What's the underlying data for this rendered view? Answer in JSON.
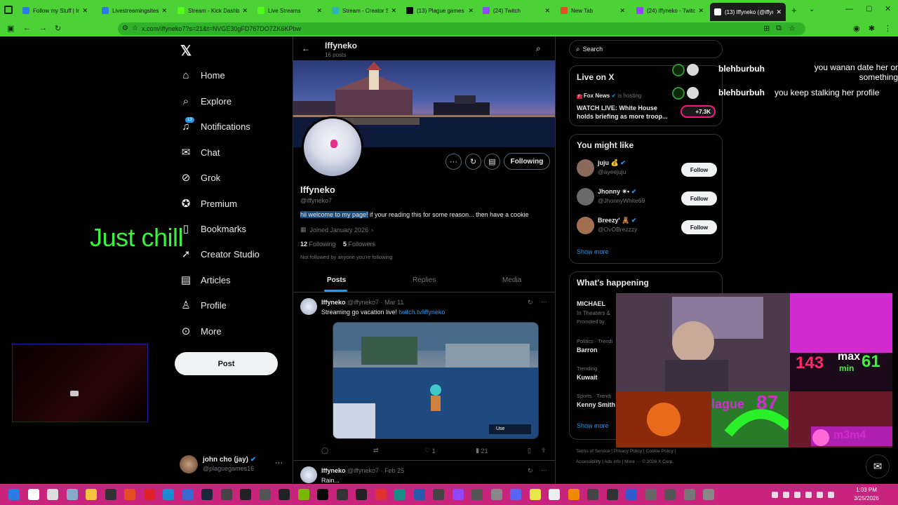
{
  "browser": {
    "tabs": [
      {
        "title": "Follow my Stuff | Insta",
        "color": "#2b7be4"
      },
      {
        "title": "Livestreamingsites | To",
        "color": "#2b7be4"
      },
      {
        "title": "Stream - Kick Dashbo",
        "color": "#53fc18"
      },
      {
        "title": "Live Streams",
        "color": "#53fc18"
      },
      {
        "title": "Stream - Creator Studi",
        "color": "#2bb5b5"
      },
      {
        "title": "(13) Plague games 16",
        "color": "#000000"
      },
      {
        "title": "(24) Twitch",
        "color": "#9146ff"
      },
      {
        "title": "New Tab",
        "color": "#e44d26"
      },
      {
        "title": "(24) iffyneko - Twitch",
        "color": "#9146ff"
      },
      {
        "title": "(13) Iffyneko (@iffyne",
        "color": "#000000"
      }
    ],
    "url": "x.com/iffyneko7?s=21&t=NVGE30gFD767DO7ZK6KPbw"
  },
  "overlay": {
    "chill_text": "Just chill",
    "chat": [
      {
        "user": "blehburbuh",
        "message": "you wanan date her or something"
      },
      {
        "user": "blehburbuh",
        "message": "you keep stalking her profile"
      }
    ],
    "stats_max": "max",
    "stats_min": "min",
    "stats_left": "143",
    "stats_right": "61",
    "plague_text": "lague",
    "plague_num": "87",
    "tag": "m3m4"
  },
  "nav": {
    "items": [
      {
        "label": "Home",
        "icon": "home-icon"
      },
      {
        "label": "Explore",
        "icon": "search-icon"
      },
      {
        "label": "Notifications",
        "icon": "bell-icon",
        "badge": "13"
      },
      {
        "label": "Chat",
        "icon": "mail-icon"
      },
      {
        "label": "Grok",
        "icon": "grok-icon"
      },
      {
        "label": "Premium",
        "icon": "verified-icon"
      },
      {
        "label": "Bookmarks",
        "icon": "bookmark-icon"
      },
      {
        "label": "Creator Studio",
        "icon": "rocket-icon"
      },
      {
        "label": "Articles",
        "icon": "article-icon"
      },
      {
        "label": "Profile",
        "icon": "person-icon"
      },
      {
        "label": "More",
        "icon": "more-icon"
      }
    ],
    "post_label": "Post",
    "account_name": "john cho (jay)",
    "account_handle": "@plaguegames16"
  },
  "profile": {
    "name": "Iffyneko",
    "posts_count": "16 posts",
    "handle": "@iffyneko7",
    "bio_highlight": "hii welcome to my page!",
    "bio_rest": " if your reading this for some reason... then have a cookie",
    "joined": "Joined January 2026",
    "following_count": "12",
    "following_label": "Following",
    "followers_count": "5",
    "followers_label": "Followers",
    "not_followed": "Not followed by anyone you're following",
    "following_button": "Following",
    "tabs": [
      "Posts",
      "Replies",
      "Media"
    ]
  },
  "tweets": [
    {
      "name": "Iffyneko",
      "handle": "@iffyneko7",
      "date": "Mar 11",
      "text": "Streaming go vacation live! ",
      "link": "twitch.tv/iffyneko",
      "replies": "",
      "retweets": "",
      "likes": "1",
      "views": "21",
      "media_label": "Use"
    },
    {
      "name": "Iffyneko",
      "handle": "@iffyneko7",
      "date": "Feb 25",
      "text": "Rain..."
    }
  ],
  "sidebar": {
    "search_placeholder": "Search",
    "live_title": "Live on X",
    "live_host": "Fox News",
    "live_hosting": "is hosting",
    "live_text": "WATCH LIVE: White House holds briefing as more troop...",
    "live_count": "+7.3K",
    "might_like_title": "You might like",
    "suggestions": [
      {
        "name": "juju 💰",
        "handle": "@ayeejuju",
        "color": "#8a6a5a"
      },
      {
        "name": "Jhonny ✴•",
        "handle": "@JhonnyWhite69",
        "color": "#6a6a6a"
      },
      {
        "name": "Breezy' 🧸",
        "handle": "@OvOBrezzzy",
        "color": "#a07050"
      }
    ],
    "follow_label": "Follow",
    "show_more": "Show more",
    "happening_title": "What's happening",
    "trends": [
      {
        "category": "",
        "name": "MICHAEL",
        "sub": "In Theaters &",
        "promo": "Promoted by"
      },
      {
        "category": "Politics · Trendi",
        "name": "Barron"
      },
      {
        "category": "Trending",
        "name": "Kuwait"
      },
      {
        "category": "Sports · Trendi",
        "name": "Kenny Smith"
      }
    ],
    "footer": [
      "Terms of Service",
      "Privacy Policy",
      "Cookie Policy",
      "Accessibility",
      "Ads info",
      "More ···",
      "© 2026 X Corp."
    ]
  },
  "taskbar": {
    "time": "1:03 PM",
    "date": "3/25/2026"
  }
}
